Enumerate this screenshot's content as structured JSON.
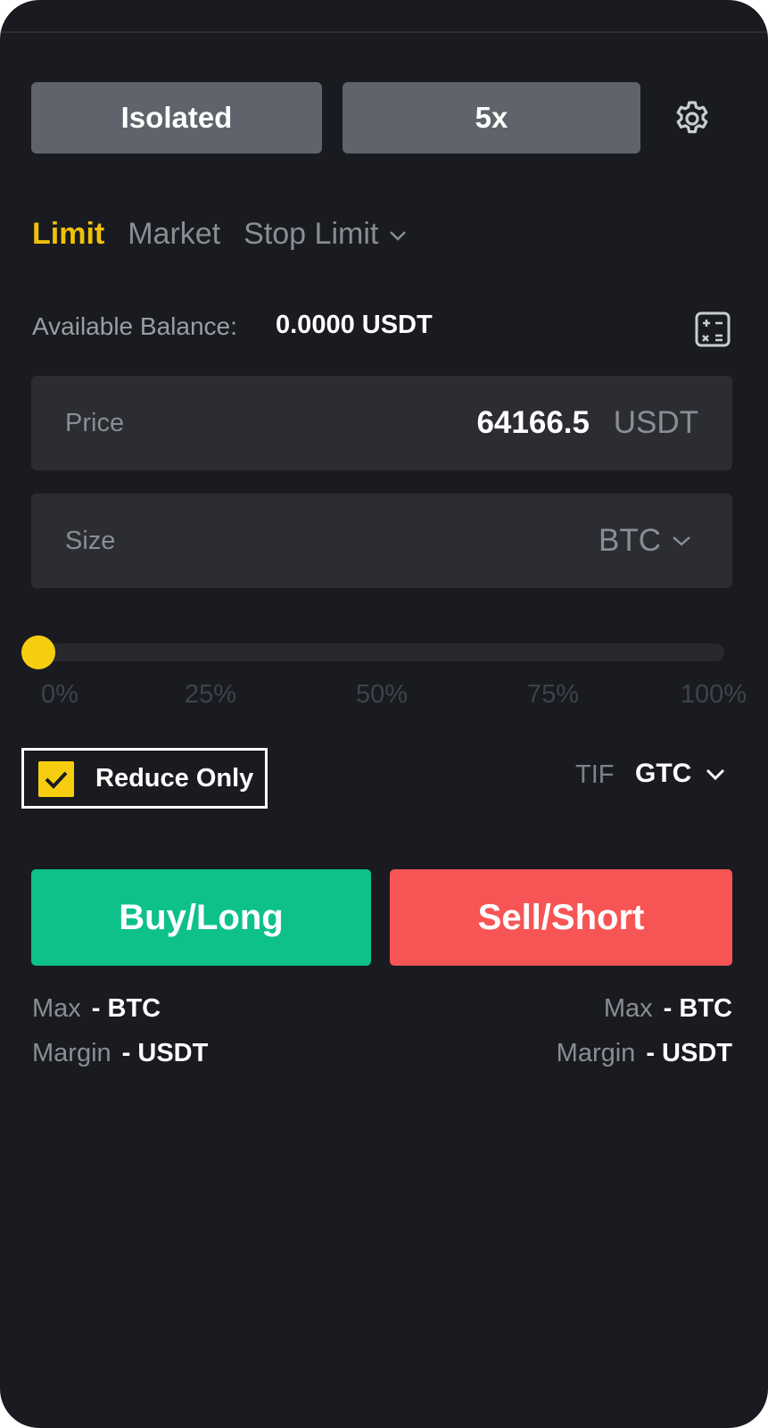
{
  "header": {
    "margin_mode_label": "Isolated",
    "leverage_label": "5x",
    "settings_icon": "gear-icon"
  },
  "order_tabs": {
    "items": [
      {
        "label": "Limit",
        "active": true
      },
      {
        "label": "Market",
        "active": false
      },
      {
        "label": "Stop Limit",
        "active": false,
        "has_dropdown": true
      }
    ]
  },
  "balance": {
    "label": "Available Balance:",
    "value": "0.0000 USDT",
    "calculator_icon": "calculator-icon"
  },
  "price_field": {
    "label": "Price",
    "value": "64166.5",
    "unit": "USDT"
  },
  "size_field": {
    "label": "Size",
    "value": "",
    "unit": "BTC"
  },
  "slider": {
    "value_percent": 0,
    "ticks": [
      "0%",
      "25%",
      "50%",
      "75%",
      "100%"
    ]
  },
  "reduce_only": {
    "label": "Reduce Only",
    "checked": true
  },
  "tif": {
    "label": "TIF",
    "value": "GTC"
  },
  "actions": {
    "buy_label": "Buy/Long",
    "sell_label": "Sell/Short"
  },
  "buy_info": {
    "max_key": "Max",
    "max_value": "- BTC",
    "margin_key": "Margin",
    "margin_value": "- USDT"
  },
  "sell_info": {
    "max_key": "Max",
    "max_value": "- BTC",
    "margin_key": "Margin",
    "margin_value": "- USDT"
  },
  "colors": {
    "background": "#1a1b20",
    "accent": "#f0c10b",
    "buy": "#0ec18b",
    "sell": "#f75555"
  }
}
